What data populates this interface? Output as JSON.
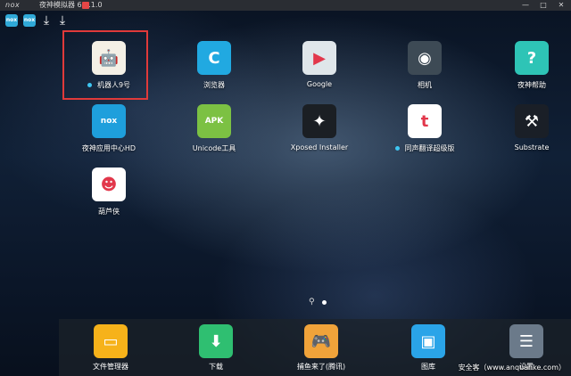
{
  "window": {
    "logo_text": "nox",
    "title": "夜神模拟器 6.0.1.0",
    "controls": [
      "—",
      "□",
      "✕"
    ]
  },
  "statusbar": {
    "icons": [
      {
        "name": "nox-app-icon",
        "text": "nox"
      },
      {
        "name": "nox-app-icon-2",
        "text": "nox"
      }
    ],
    "downloads": [
      "⤓",
      "⤓"
    ]
  },
  "home_apps": [
    {
      "label": "机器人9号",
      "icon": "robot-icon",
      "color": "#f4f0e6",
      "glyph": "🤖",
      "has_dot": true
    },
    {
      "label": "浏览器",
      "icon": "browser-icon",
      "color": "#21a9e1",
      "glyph": "C",
      "has_dot": false
    },
    {
      "label": "Google",
      "icon": "google-folder-icon",
      "color": "#dfe6ea",
      "glyph": "▶",
      "has_dot": false
    },
    {
      "label": "相机",
      "icon": "camera-icon",
      "color": "#3d4a55",
      "glyph": "◉",
      "has_dot": false
    },
    {
      "label": "夜神帮助",
      "icon": "help-icon",
      "color": "#2ec4b6",
      "glyph": "?",
      "has_dot": false
    },
    {
      "label": "夜神应用中心HD",
      "icon": "app-center-icon",
      "color": "#1e9fdc",
      "glyph": "nox",
      "has_dot": false
    },
    {
      "label": "Unicode工具",
      "icon": "apk-tool-icon",
      "color": "#7cc143",
      "glyph": "APK",
      "has_dot": false
    },
    {
      "label": "Xposed Installer",
      "icon": "xposed-icon",
      "color": "#1b1f24",
      "glyph": "✦",
      "has_dot": false
    },
    {
      "label": "同声翻译超级版",
      "icon": "translate-icon",
      "color": "#ffffff",
      "glyph": "t",
      "has_dot": true
    },
    {
      "label": "Substrate",
      "icon": "substrate-icon",
      "color": "#1a1f27",
      "glyph": "⚒",
      "has_dot": false
    },
    {
      "label": "葫芦侠",
      "icon": "gourd-icon",
      "color": "#ffffff",
      "glyph": "☻",
      "has_dot": false
    }
  ],
  "dock_apps": [
    {
      "label": "文件管理器",
      "icon": "folder-icon",
      "color": "#f6b21a",
      "glyph": "▭"
    },
    {
      "label": "下载",
      "icon": "download-icon",
      "color": "#2fbf71",
      "glyph": "⬇"
    },
    {
      "label": "捕鱼来了(腾讯)",
      "icon": "fishing-game-icon",
      "color": "#f0a33a",
      "glyph": "🎮"
    },
    {
      "label": "图库",
      "icon": "gallery-icon",
      "color": "#2aa4e8",
      "glyph": "▣"
    },
    {
      "label": "设置",
      "icon": "settings-icon",
      "color": "#6b7a8a",
      "glyph": "☰"
    }
  ],
  "watermark": "安全客（www.anquanke.com）"
}
